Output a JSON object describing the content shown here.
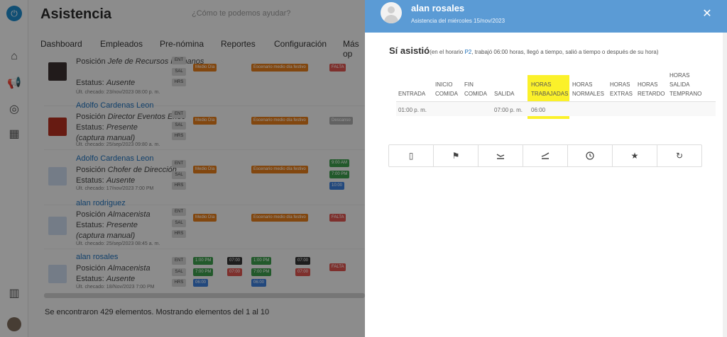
{
  "app": {
    "title": "Asistencia",
    "search_placeholder": "¿Cómo te podemos ayudar?"
  },
  "nav": [
    "Dashboard",
    "Empleados",
    "Pre-nómina",
    "Reportes",
    "Configuración",
    "Más op"
  ],
  "rows": [
    {
      "name": "",
      "position_label": "Posición",
      "position": "Jefe de Recursos Humanos",
      "status_label": "Estatus:",
      "status": "Ausente",
      "checked": "Últ. checado: 23/nov/2023 08:00 p. m.",
      "tags": [
        "ENT",
        "SAL",
        "HRS"
      ],
      "t1": "Medio Día",
      "t2": "Escenario medio día festivo",
      "t3": "FALTA"
    },
    {
      "name": "Adolfo Cardenas Leon",
      "position_label": "Posición",
      "position": "Director Eventos Erioc",
      "status_label": "Estatus:",
      "status": "Presente (captura manual)",
      "checked": "Últ. checado: 25/sep/2023 09:80 a. m.",
      "tags": [
        "ENT",
        "SAL",
        "HRS"
      ],
      "t1": "Medio Día",
      "t2": "Escenario medio día festivo",
      "t3": "Descanso"
    },
    {
      "name": "Adolfo Cardenas Leon",
      "position_label": "Posición",
      "position": "Chofer de Dirección",
      "status_label": "Estatus:",
      "status": "Ausente",
      "checked": "Últ. checado: 17/nov/2023 7:00 PM",
      "tags": [
        "ENT",
        "SAL",
        "HRS"
      ],
      "t1": "Medio Día",
      "t2": "Escenario medio día festivo",
      "extra": [
        "9:00 AM",
        "7:00 PM",
        "10:00"
      ]
    },
    {
      "name": "alan rodriguez",
      "position_label": "Posición",
      "position": "Almacenista",
      "status_label": "Estatus:",
      "status": "Presente (captura manual)",
      "checked": "Últ. checado: 25/sep/2023 08:45 a. m.",
      "tags": [
        "ENT",
        "SAL",
        "HRS"
      ],
      "t1": "Medio Día",
      "t2": "Escenario medio día festivo",
      "t3": "FALTA"
    },
    {
      "name": "alan rosales",
      "position_label": "Posición",
      "position": "Almacenista",
      "status_label": "Estatus:",
      "status": "Ausente",
      "checked": "Últ. checado: 18/Nov/2023 7:00 PM",
      "tags": [
        "ENT",
        "SAL",
        "HRS"
      ],
      "g1": [
        "1:00 PM",
        "7:00 PM",
        "06:00"
      ],
      "d1": [
        "07:00",
        "07:00"
      ],
      "g2": [
        "1:00 PM",
        "7:00 PM",
        "06:00"
      ],
      "d2": [
        "07:00",
        "07:00"
      ],
      "t3": "FALTA"
    }
  ],
  "footer": {
    "count_text": "Se encontraron 429 elementos. Mostrando elementos del 1 al 10"
  },
  "panel": {
    "name": "alan rosales",
    "subtitle": "Asistencia del miércoles 15/nov/2023",
    "status_main": "Sí asistió",
    "status_prefix": "(en el horario ",
    "status_link": "P2",
    "status_suffix": ", trabajó 06:00 horas, llegó a tiempo, salió a tiempo o después de su hora)",
    "headers": {
      "entrada": [
        "ENTRADA"
      ],
      "inicio": [
        "INICIO",
        "COMIDA"
      ],
      "fin": [
        "FIN",
        "COMIDA"
      ],
      "salida": [
        "SALIDA"
      ],
      "trabajadas": [
        "HORAS",
        "TRABAJADAS"
      ],
      "normales": [
        "HORAS",
        "NORMALES"
      ],
      "extras": [
        "HORAS",
        "EXTRAS"
      ],
      "retardo": [
        "HORAS",
        "RETARDO"
      ],
      "temprano": [
        "HORAS",
        "SALIDA",
        "TEMPRANO"
      ]
    },
    "values": {
      "entrada": "01:00 p. m.",
      "salida": "07:00 p. m.",
      "trabajadas": "06:00"
    },
    "highlight_color": "#fbf12a"
  },
  "actions": [
    "mobile-icon",
    "flag-icon",
    "landing-icon",
    "takeoff-icon",
    "clock-icon",
    "star-icon",
    "refresh-icon"
  ],
  "colors": {
    "header_blue": "#5b9bd5",
    "link_blue": "#1e6fb8",
    "tag_orange": "#e07b1a",
    "tag_red": "#d9534f",
    "tag_green": "#3c9a4a",
    "tag_blue": "#3b7dd8"
  }
}
